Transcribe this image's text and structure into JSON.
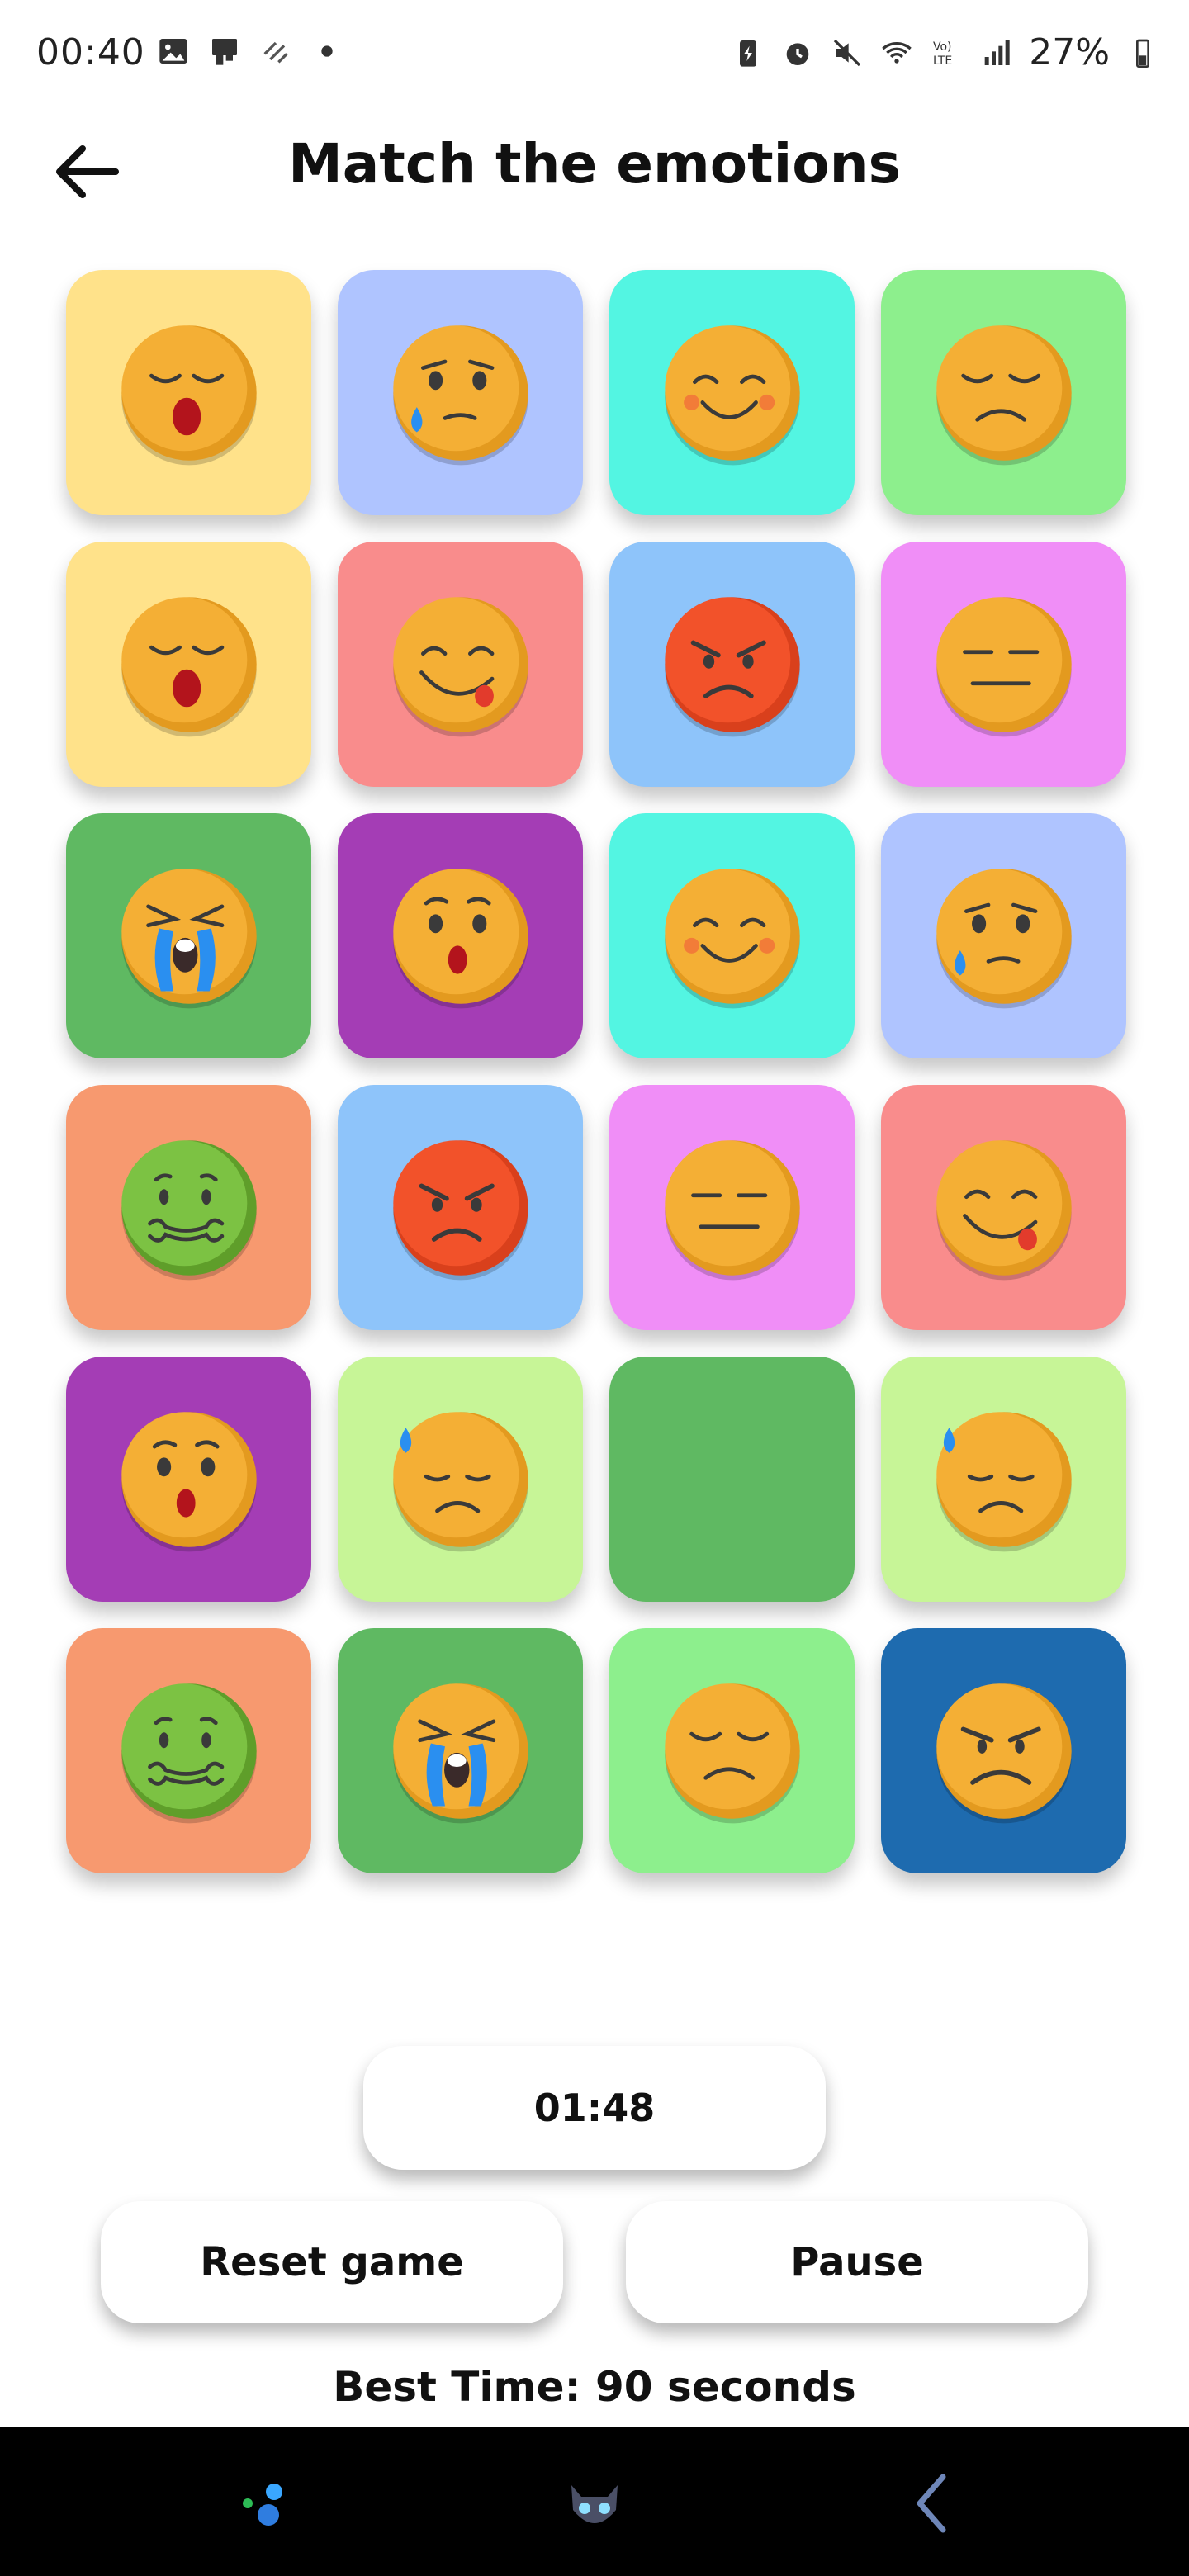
{
  "status_bar": {
    "time": "00:40",
    "battery": "27%",
    "left_icons": [
      "image-icon",
      "cast-icon",
      "data-saver-icon",
      "dot-icon"
    ],
    "right_icons": [
      "battery-saver-icon",
      "alarm-icon",
      "mute-icon",
      "wifi-icon",
      "volte-icon",
      "signal-icon",
      "battery-icon"
    ],
    "volte_label": "Vo) LTE"
  },
  "header": {
    "title": "Match the emotions",
    "back_icon": "arrow-left-icon"
  },
  "grid": {
    "cards": [
      {
        "bg": "#FFE28A",
        "emoji": "sleepy-yawn"
      },
      {
        "bg": "#AFC4FF",
        "emoji": "sad-tear"
      },
      {
        "bg": "#53F5E2",
        "emoji": "happy-blush"
      },
      {
        "bg": "#8DEF8D",
        "emoji": "disappointed"
      },
      {
        "bg": "#FFE28A",
        "emoji": "sleepy-yawn"
      },
      {
        "bg": "#F98C8C",
        "emoji": "tongue-out"
      },
      {
        "bg": "#8EC4FA",
        "emoji": "angry"
      },
      {
        "bg": "#F08EF7",
        "emoji": "neutral"
      },
      {
        "bg": "#5FB962",
        "emoji": "crying"
      },
      {
        "bg": "#A43DB5",
        "emoji": "surprised"
      },
      {
        "bg": "#53F5E2",
        "emoji": "happy-blush"
      },
      {
        "bg": "#AFC4FF",
        "emoji": "sad-tear"
      },
      {
        "bg": "#F7996F",
        "emoji": "nauseated"
      },
      {
        "bg": "#8EC4FA",
        "emoji": "angry"
      },
      {
        "bg": "#F08EF7",
        "emoji": "neutral"
      },
      {
        "bg": "#F98C8C",
        "emoji": "tongue-out"
      },
      {
        "bg": "#A43DB5",
        "emoji": "surprised"
      },
      {
        "bg": "#C7F597",
        "emoji": "sweat-sad"
      },
      {
        "bg": "#5FB962",
        "emoji": "hidden"
      },
      {
        "bg": "#C7F597",
        "emoji": "sweat-sad"
      },
      {
        "bg": "#F7996F",
        "emoji": "nauseated"
      },
      {
        "bg": "#5FB962",
        "emoji": "crying"
      },
      {
        "bg": "#8DEF8D",
        "emoji": "disappointed"
      },
      {
        "bg": "#1E6BAF",
        "emoji": "frowning-angry"
      }
    ]
  },
  "timer": {
    "value": "01:48"
  },
  "buttons": {
    "reset_label": "Reset game",
    "pause_label": "Pause"
  },
  "best_time": {
    "text": "Best Time: 90 seconds"
  },
  "nav_bar": {
    "icons": [
      "multi-window-icon",
      "assistant-avatar-icon",
      "back-gesture-icon"
    ]
  }
}
